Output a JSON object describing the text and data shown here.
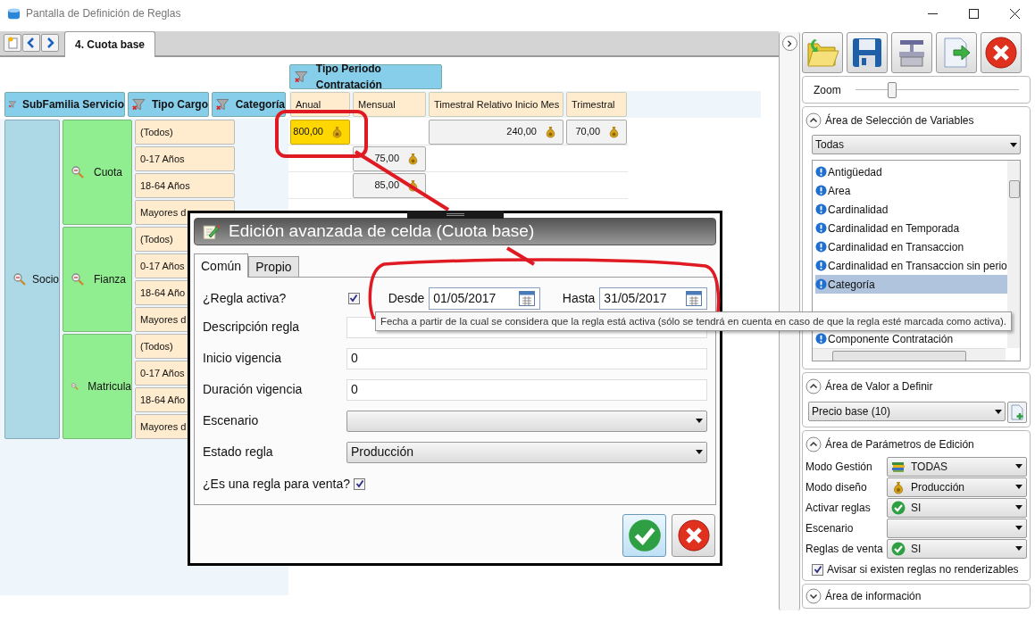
{
  "window": {
    "title": "Pantalla de Definición de Reglas"
  },
  "tabs": [
    {
      "label": "4. Cuota base",
      "selected": true
    }
  ],
  "grid": {
    "group_header": "Tipo Periodo Contratación",
    "row_headers": [
      "SubFamilia Servicio",
      "Tipo Cargo",
      "Categoría"
    ],
    "columns": [
      "Anual",
      "Mensual",
      "Timestral Relativo Inicio Mes",
      "Trimestral"
    ],
    "level1": "Socio",
    "groups": [
      {
        "label": "Cuota",
        "categories": [
          {
            "label": "(Todos)",
            "cells": [
              {
                "value": "800,00",
                "selected": true
              },
              null,
              {
                "value": "240,00",
                "selected": false
              },
              {
                "value": "70,00",
                "selected": false
              }
            ]
          },
          {
            "label": "0-17 Años",
            "cells": [
              null,
              {
                "value": "75,00",
                "selected": false
              },
              null,
              null
            ]
          },
          {
            "label": "18-64 Años",
            "cells": [
              null,
              {
                "value": "85,00",
                "selected": false
              },
              null,
              null
            ]
          },
          {
            "label": "Mayores d",
            "cells": [
              null,
              null,
              null,
              null
            ]
          }
        ]
      },
      {
        "label": "Fianza",
        "categories": [
          {
            "label": "(Todos)"
          },
          {
            "label": "0-17 Años"
          },
          {
            "label": "18-64 Año"
          },
          {
            "label": "Mayores d"
          }
        ]
      },
      {
        "label": "Matricula",
        "categories": [
          {
            "label": "(Todos)"
          },
          {
            "label": "0-17 Años"
          },
          {
            "label": "18-64 Año"
          },
          {
            "label": "Mayores d"
          }
        ]
      }
    ]
  },
  "dialog": {
    "title": "Edición avanzada de celda (Cuota base)",
    "tabs": [
      {
        "label": "Común",
        "selected": true
      },
      {
        "label": "Propio",
        "selected": false
      }
    ],
    "active": {
      "label": "¿Regla activa?",
      "checked": true
    },
    "from": {
      "label": "Desde",
      "value": "01/05/2017"
    },
    "to": {
      "label": "Hasta",
      "value": "31/05/2017"
    },
    "fields": [
      {
        "kind": "text",
        "label": "Descripción regla"
      },
      {
        "kind": "text",
        "label": "Inicio vigencia",
        "value": "0"
      },
      {
        "kind": "text",
        "label": "Duración vigencia",
        "value": "0"
      },
      {
        "kind": "select",
        "label": "Escenario"
      },
      {
        "kind": "select",
        "label": "Estado regla",
        "value": "Producción"
      }
    ],
    "sale": {
      "label": "¿Es una regla para venta?",
      "checked": true
    }
  },
  "tooltip": "Fecha a partir de la cual se considera que la regla está activa (sólo se tendrá en cuenta en caso de que la regla esté marcada como activa).",
  "sidebar": {
    "zoom": {
      "label": "Zoom",
      "level": 0.2
    },
    "variables": {
      "title": "Área de Selección de Variables",
      "expanded": true,
      "filter": "Todas",
      "items": [
        {
          "label": "Antigüedad",
          "selected": false
        },
        {
          "label": "Area",
          "selected": false
        },
        {
          "label": "Cardinalidad",
          "selected": false
        },
        {
          "label": "Cardinalidad en Temporada",
          "selected": false
        },
        {
          "label": "Cardinalidad en Transaccion",
          "selected": false
        },
        {
          "label": "Cardinalidad en Transaccion sin perio",
          "selected": false
        },
        {
          "label": "Categoría",
          "selected": true
        }
      ],
      "items_below": [
        {
          "label": "Componente Contratación",
          "selected": false
        }
      ]
    },
    "value_area": {
      "title": "Área de Valor a Definir",
      "expanded": true,
      "value": "Precio base (10)"
    },
    "params": {
      "title": "Área de Parámetros de Edición",
      "expanded": true,
      "rows": [
        {
          "label": "Modo Gestión",
          "value": "TODAS",
          "kind": "books"
        },
        {
          "label": "Modo diseño",
          "value": "Producción",
          "kind": "bag"
        },
        {
          "label": "Activar reglas",
          "value": "SI",
          "kind": "check"
        },
        {
          "label": "Escenario",
          "kind": "empty"
        },
        {
          "label": "Reglas de venta",
          "value": "SI",
          "kind": "check"
        }
      ],
      "warn": {
        "label": "Avisar si existen reglas no renderizables",
        "checked": true
      }
    },
    "info": {
      "title": "Área de información",
      "expanded": false
    }
  }
}
